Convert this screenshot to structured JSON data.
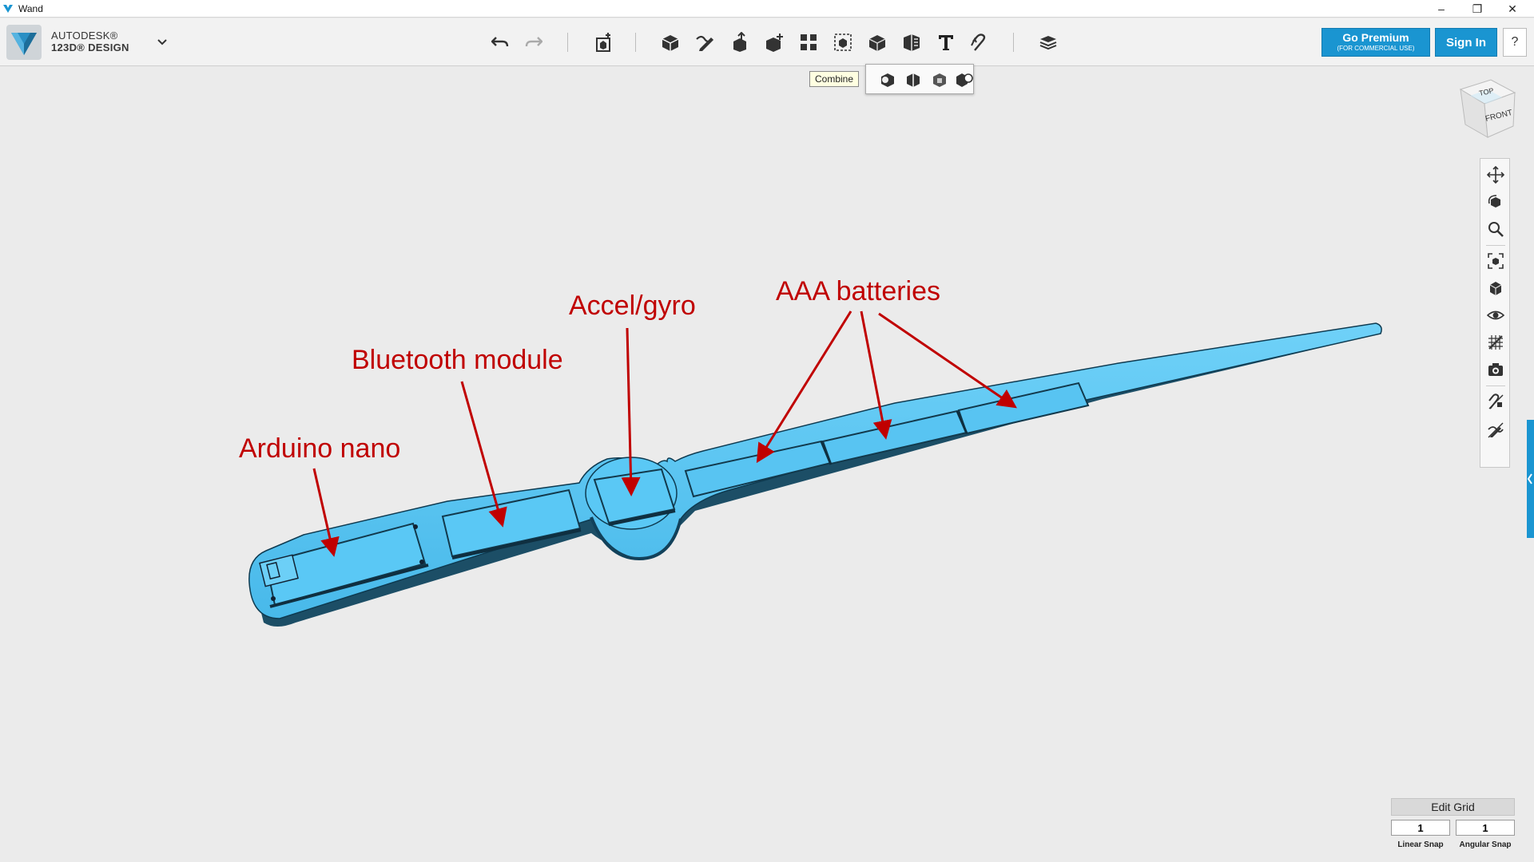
{
  "window": {
    "title": "Wand",
    "controls": {
      "minimize": "–",
      "restore": "❐",
      "close": "✕"
    }
  },
  "brand": {
    "line1": "AUTODESK®",
    "line2": "123D® DESIGN"
  },
  "toolbar": {
    "icons": [
      "undo-icon",
      "redo-icon",
      "transform-icon",
      "primitives-icon",
      "sketch-icon",
      "construct-icon",
      "modify-icon",
      "pattern-icon",
      "grouping-icon",
      "combine-icon",
      "measure-icon",
      "text-icon",
      "snap-icon",
      "material-icon"
    ],
    "premium_label": "Go Premium",
    "premium_sub": "(FOR COMMERCIAL USE)",
    "signin_label": "Sign In",
    "help_label": "?"
  },
  "combine_tooltip": "Combine",
  "viewcube": {
    "top": "TOP",
    "front": "FRONT"
  },
  "annotations": {
    "arduino": "Arduino nano",
    "bluetooth": "Bluetooth module",
    "accel": "Accel/gyro",
    "batteries": "AAA batteries"
  },
  "grid": {
    "edit_label": "Edit Grid",
    "linear_value": "1",
    "angular_value": "1",
    "linear_label": "Linear Snap",
    "angular_label": "Angular Snap"
  },
  "colors": {
    "model": "#5ac8f5",
    "model_dark": "#1d5c78",
    "annotation": "#c00000",
    "accent": "#1a95d1"
  }
}
